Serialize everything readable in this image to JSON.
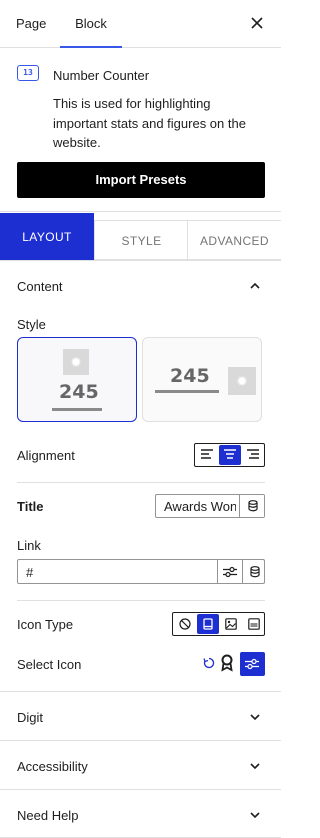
{
  "tabs": {
    "page": "Page",
    "block": "Block"
  },
  "block": {
    "icon_text": "13",
    "title": "Number Counter",
    "description": "This is used for highlighting important stats and figures on the website.",
    "import_button": "Import Presets"
  },
  "subtabs": {
    "layout": "LAYOUT",
    "style": "STYLE",
    "advanced": "ADVANCED"
  },
  "content": {
    "heading": "Content",
    "style_label": "Style",
    "style_options": [
      {
        "number": "245"
      },
      {
        "number": "245"
      }
    ],
    "alignment_label": "Alignment",
    "title_label": "Title",
    "title_value": "Awards Won",
    "link_label": "Link",
    "link_value": "#",
    "icon_type_label": "Icon Type",
    "select_icon_label": "Select Icon"
  },
  "sections": {
    "digit": "Digit",
    "accessibility": "Accessibility",
    "need_help": "Need Help"
  },
  "colors": {
    "accent": "#1e2fd1",
    "tab_indicator": "#3858e9"
  }
}
